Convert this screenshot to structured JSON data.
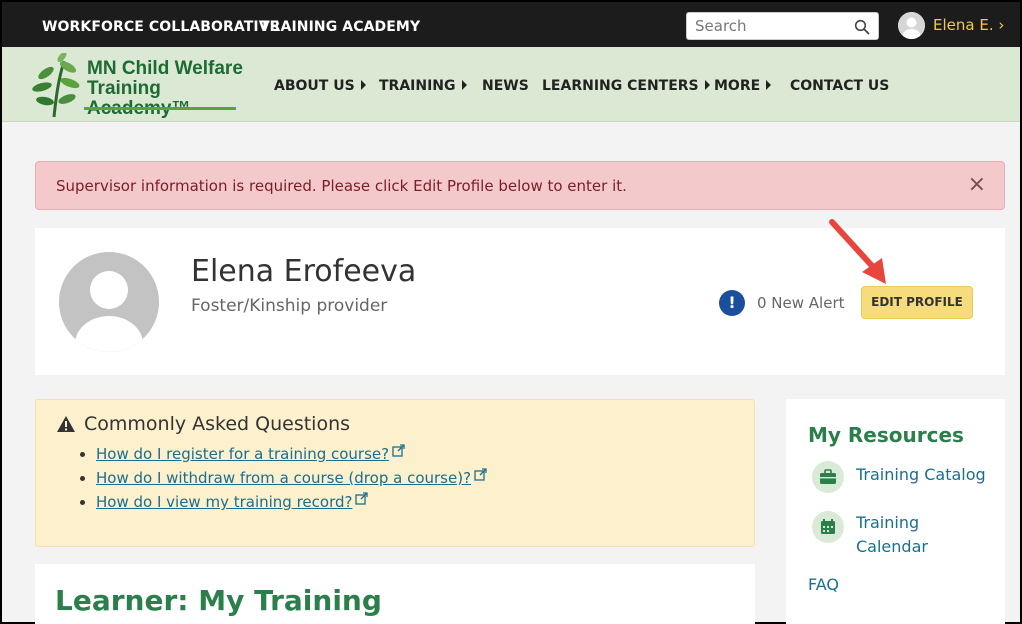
{
  "topbar": {
    "link1": "WORKFORCE COLLABORATIVE",
    "link2": "TRAINING ACADEMY",
    "search_placeholder": "Search",
    "user_name": "Elena E. ›"
  },
  "logo": {
    "line1": "MN Child Welfare",
    "line2": "Training Academy™"
  },
  "nav": {
    "items": [
      "ABOUT US",
      "TRAINING",
      "NEWS",
      "LEARNING CENTERS",
      "MORE",
      "CONTACT US"
    ]
  },
  "alert": {
    "message": "Supervisor information is required. Please click Edit Profile below to enter it.",
    "close": "×"
  },
  "profile": {
    "name": "Elena Erofeeva",
    "role": "Foster/Kinship provider",
    "alert_icon": "!",
    "alert_count": "0 New Alert",
    "edit_label": "EDIT PROFILE"
  },
  "faq": {
    "title": "Commonly Asked Questions",
    "links": [
      "How do I register for a training course?",
      "How do I withdraw from a course (drop a course)?",
      "How do I view my training record?"
    ]
  },
  "training": {
    "title": "Learner: My Training"
  },
  "resources": {
    "title": "My Resources",
    "catalog": "Training Catalog",
    "calendar_line1": "Training",
    "calendar_line2": "Calendar",
    "faq": "FAQ"
  },
  "colors": {
    "topbar": "#1c1c1c",
    "nav_bg": "#dbe8d3",
    "brand_green": "#2a7f4a",
    "link_blue": "#1a6f8e",
    "edit_button": "#f7dc7e",
    "alert_bg": "#f4c9cc",
    "arrow": "#e8453c"
  },
  "icons": {
    "search": "search-icon",
    "user": "user-avatar-icon",
    "warning": "warning-triangle-icon",
    "external": "external-link-icon",
    "briefcase": "briefcase-icon",
    "calendar": "calendar-icon",
    "annotation": "red-arrow-annotation"
  }
}
